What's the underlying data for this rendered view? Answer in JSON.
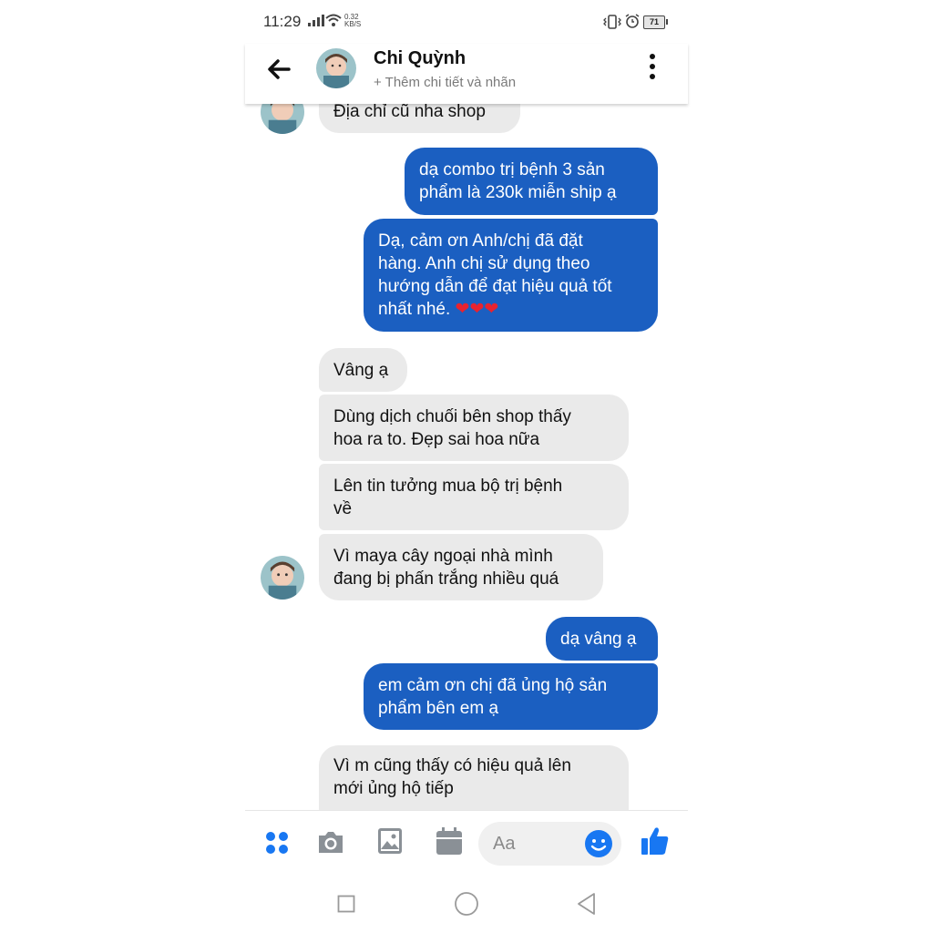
{
  "status_bar": {
    "time": "11:29",
    "net_speed_value": "0.32",
    "net_speed_unit": "KB/S",
    "battery": "71"
  },
  "header": {
    "contact_name": "Chi Quỳnh",
    "subtitle": "+ Thêm chi tiết và nhãn"
  },
  "colors": {
    "outgoing_bubble": "#1b5fc1",
    "incoming_bubble": "#eaeaea",
    "accent": "#1877f2"
  },
  "messages": [
    {
      "from": "contact",
      "lines": [
        "Địa chỉ cũ nha shop"
      ]
    },
    {
      "from": "me",
      "lines": [
        "dạ combo trị bệnh 3 sản",
        "phẩm là 230k miễn ship ạ"
      ]
    },
    {
      "from": "me",
      "lines": [
        "Dạ, cảm ơn Anh/chị đã đặt",
        "hàng. Anh chị sử dụng theo",
        "hướng dẫn để đạt hiệu quả tốt",
        "nhất nhé. ❤❤❤"
      ]
    },
    {
      "from": "contact",
      "lines": [
        "Vâng ạ"
      ]
    },
    {
      "from": "contact",
      "lines": [
        "Dùng dịch chuối bên shop thấy",
        "hoa ra to. Đẹp sai hoa nữa"
      ]
    },
    {
      "from": "contact",
      "lines": [
        "Lên tin tưởng mua bộ trị bệnh",
        "về"
      ]
    },
    {
      "from": "contact",
      "lines": [
        "Vì maya cây ngoại nhà mình",
        "đang bị phấn trắng nhiều quá"
      ]
    },
    {
      "from": "me",
      "lines": [
        "dạ vâng ạ"
      ]
    },
    {
      "from": "me",
      "lines": [
        "em cảm ơn chị đã ủng  hộ sản",
        "phẩm bên em ạ"
      ]
    },
    {
      "from": "contact",
      "lines": [
        "Vì m cũng thấy có hiệu quả lên",
        "mới ủng hộ tiếp"
      ]
    }
  ],
  "composer": {
    "placeholder": "Aa",
    "icons": [
      "apps-icon",
      "camera-icon",
      "gallery-icon",
      "calendar-icon",
      "emoji-icon",
      "thumbs-up-icon"
    ]
  },
  "nav_bar": {
    "icons": [
      "recents-icon",
      "home-icon",
      "back-icon"
    ]
  }
}
